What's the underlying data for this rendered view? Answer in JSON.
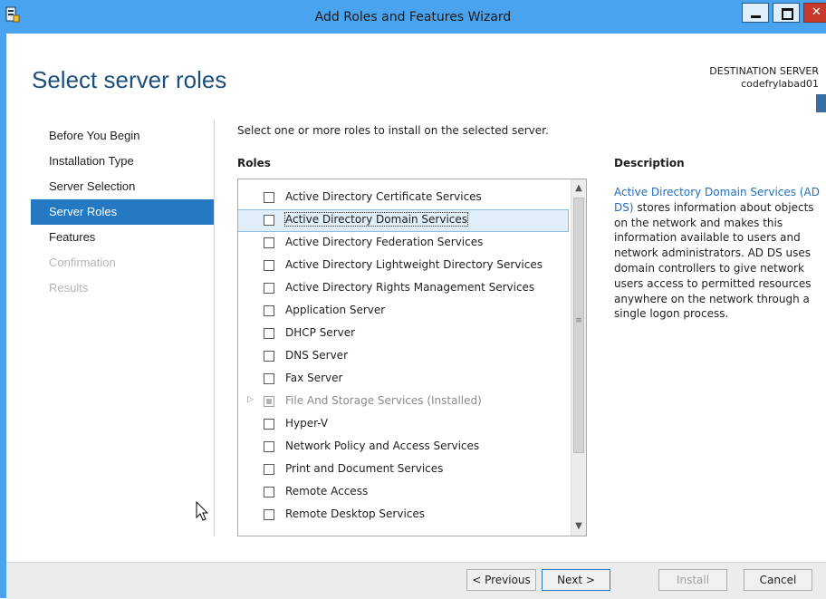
{
  "window": {
    "title": "Add Roles and Features Wizard",
    "close_glyph": "✕"
  },
  "header": {
    "page_title": "Select server roles",
    "destination_label": "DESTINATION SERVER",
    "destination_value": "codefrylabad01"
  },
  "nav": {
    "items": [
      {
        "label": "Before You Begin",
        "state": "normal"
      },
      {
        "label": "Installation Type",
        "state": "normal"
      },
      {
        "label": "Server Selection",
        "state": "normal"
      },
      {
        "label": "Server Roles",
        "state": "active"
      },
      {
        "label": "Features",
        "state": "normal"
      },
      {
        "label": "Confirmation",
        "state": "disabled"
      },
      {
        "label": "Results",
        "state": "disabled"
      }
    ]
  },
  "main": {
    "instruction": "Select one or more roles to install on the selected server.",
    "roles_heading": "Roles",
    "description_heading": "Description",
    "roles": [
      {
        "label": "Active Directory Certificate Services",
        "checked": false
      },
      {
        "label": "Active Directory Domain Services",
        "checked": false,
        "selected": true
      },
      {
        "label": "Active Directory Federation Services",
        "checked": false
      },
      {
        "label": "Active Directory Lightweight Directory Services",
        "checked": false
      },
      {
        "label": "Active Directory Rights Management Services",
        "checked": false
      },
      {
        "label": "Application Server",
        "checked": false
      },
      {
        "label": "DHCP Server",
        "checked": false
      },
      {
        "label": "DNS Server",
        "checked": false
      },
      {
        "label": "Fax Server",
        "checked": false
      },
      {
        "label": "File And Storage Services (Installed)",
        "checked": "partial",
        "installed": true,
        "expandable": true
      },
      {
        "label": "Hyper-V",
        "checked": false
      },
      {
        "label": "Network Policy and Access Services",
        "checked": false
      },
      {
        "label": "Print and Document Services",
        "checked": false
      },
      {
        "label": "Remote Access",
        "checked": false
      },
      {
        "label": "Remote Desktop Services",
        "checked": false
      }
    ],
    "description_link": "Active Directory Domain Services (AD DS)",
    "description_text": " stores information about objects on the network and makes this information available to users and network administrators. AD DS uses domain controllers to give network users access to permitted resources anywhere on the network through a single logon process."
  },
  "footer": {
    "previous": "< Previous",
    "next": "Next >",
    "install": "Install",
    "cancel": "Cancel"
  },
  "icons": {
    "scroll_up": "▲",
    "scroll_down": "▼",
    "expander": "▷",
    "grip": "≡"
  },
  "colors": {
    "titlebar": "#4aa3ee",
    "nav_active": "#2479c2",
    "title_text": "#1d4f7c",
    "link": "#1f6fbf"
  }
}
